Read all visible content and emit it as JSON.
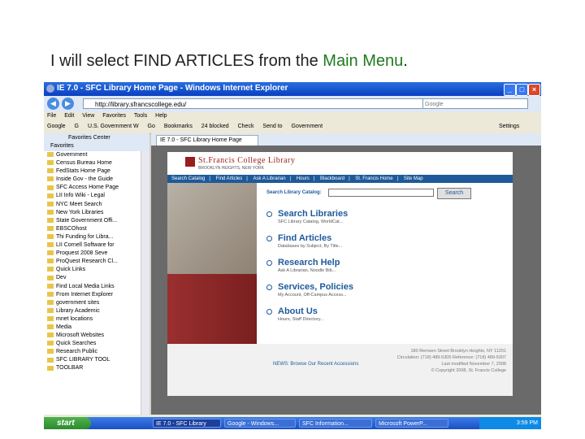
{
  "caption": {
    "prefix": "I will select FIND ARTICLES from the ",
    "highlight": "Main Menu",
    "suffix": "."
  },
  "window": {
    "title": "IE 7.0 - SFC Library Home Page - Windows Internet Explorer",
    "url": "http://library.sfrancscollege.edu/",
    "search_placeholder": "Google",
    "menu": [
      "File",
      "Edit",
      "View",
      "Favorites",
      "Tools",
      "Help"
    ],
    "toolbar": [
      "Google",
      "G",
      "U.S. Government W",
      "Go",
      "Bookmarks",
      "24 blocked",
      "Check",
      "Send to",
      "Government"
    ],
    "settings_label": "Settings",
    "favorites_center": "Favorites Center",
    "favorites_button": "Favorites",
    "tab_label": "IE 7.0 - SFC Library Home Page"
  },
  "favorites": [
    "Government",
    "Census Bureau Home",
    "FedStats Home Page",
    "Inside Gov - the Guide",
    "SFC Access Home Page",
    "LII Info Wiki - Legal",
    "NYC Meet Search",
    "New York Libraries",
    "State Government Offi...",
    "EBSCOhost",
    "Thi Funding for Libra...",
    "LII Cornell Software for",
    "Proquest 2008 Seve",
    "ProQuest Research Cl...",
    "Quick Links",
    "Dev",
    "Find Local Media Links",
    "From Internet Explorer",
    "government sites",
    "Library Academic",
    "mnet locations",
    "Media",
    "Microsoft Websites",
    "Quick Searches",
    "Research Public",
    "SFC LIBRARY TOOL",
    "TOOLBAR"
  ],
  "site": {
    "name": "St.Francis College Library",
    "address": "BROOKLYN HEIGHTS, NEW YORK",
    "nav": [
      "Search Catalog",
      "Find Articles",
      "Ask A Librarian",
      "Hours",
      "Blackboard",
      "St. Francis Home",
      "Site Map"
    ],
    "catalog_label": "Search Library Catalog:",
    "search_button": "Search",
    "menu": [
      {
        "title": "Search Libraries",
        "sub": "SFC Library Catalog, WorldCat..."
      },
      {
        "title": "Find Articles",
        "sub": "Databases by Subject, By Title..."
      },
      {
        "title": "Research Help",
        "sub": "Ask A Librarian, Noodle Bib..."
      },
      {
        "title": "Services, Policies",
        "sub": "My Account, Off-Campus Access..."
      },
      {
        "title": "About Us",
        "sub": "Hours, Staff Directory..."
      }
    ],
    "footer": [
      "180 Remsen Street Brooklyn Heights, NY 11201",
      "Circulation: (718) 489-5305  Reference: (718) 489-5307",
      "Last modified November 7, 2008",
      "© Copyright 2008, St. Francis College"
    ],
    "news": "NEWS: Browse Our Recent Accessions"
  },
  "taskbar": {
    "start": "start",
    "tasks": [
      "IE 7.0 - SFC Library",
      "Google - Windows...",
      "SFC Information...",
      "Microsoft PowerP..."
    ],
    "clock": "3:59 PM"
  }
}
